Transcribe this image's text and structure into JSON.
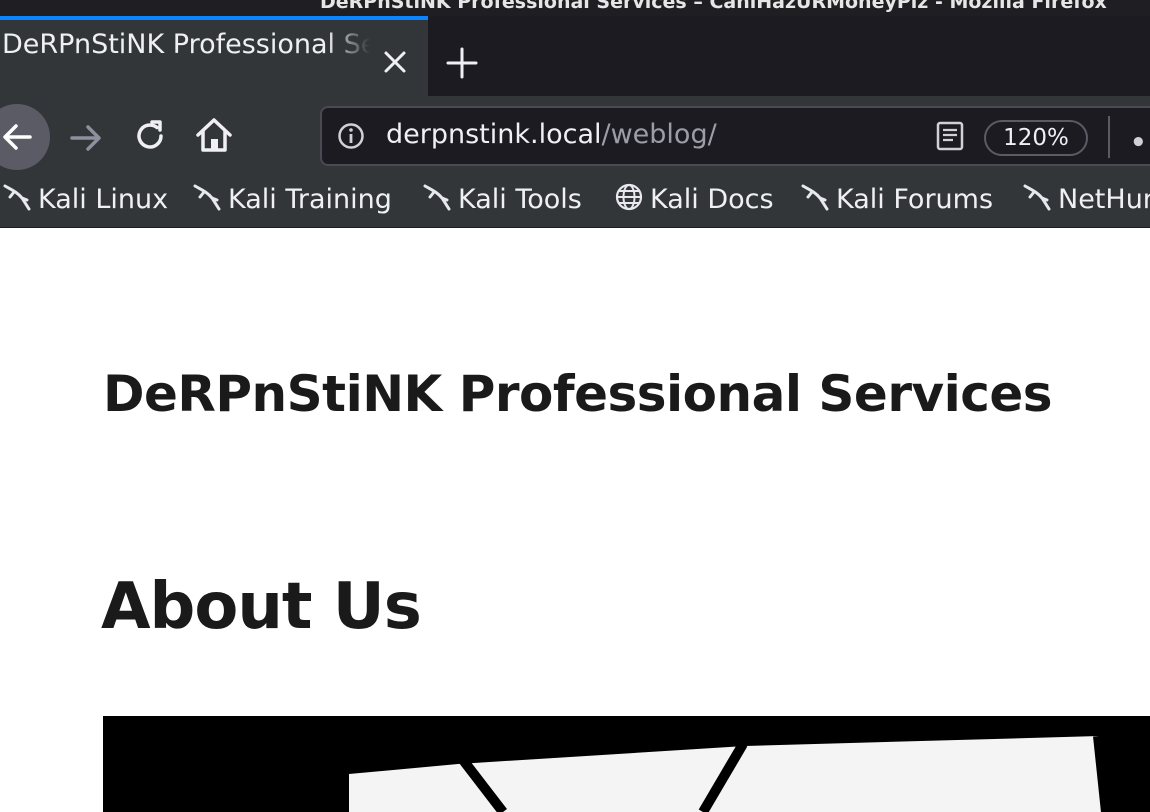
{
  "window": {
    "title": "DeRPnStiNK Professional Services – CaniHazURMoneyPlz - Mozilla Firefox"
  },
  "tabs": [
    {
      "label": "DeRPnStiNK Professional Services – CaniHazURMoneyPlz",
      "active": true
    }
  ],
  "navbar": {
    "url_host": "derpnstink.local",
    "url_path": "/weblog/",
    "zoom": "120%"
  },
  "bookmarks": [
    {
      "label": "Kali Linux",
      "icon": "kali-dragon-icon"
    },
    {
      "label": "Kali Training",
      "icon": "kali-dragon-icon"
    },
    {
      "label": "Kali Tools",
      "icon": "kali-dragon-icon"
    },
    {
      "label": "Kali Docs",
      "icon": "globe-icon"
    },
    {
      "label": "Kali Forums",
      "icon": "kali-dragon-icon"
    },
    {
      "label": "NetHunter",
      "icon": "kali-dragon-icon"
    }
  ],
  "page": {
    "site_title": "DeRPnStiNK Professional Services",
    "heading": "About Us"
  },
  "colors": {
    "accent": "#0a84ff",
    "toolbar": "#323639",
    "tabstrip": "#1c1b22"
  }
}
